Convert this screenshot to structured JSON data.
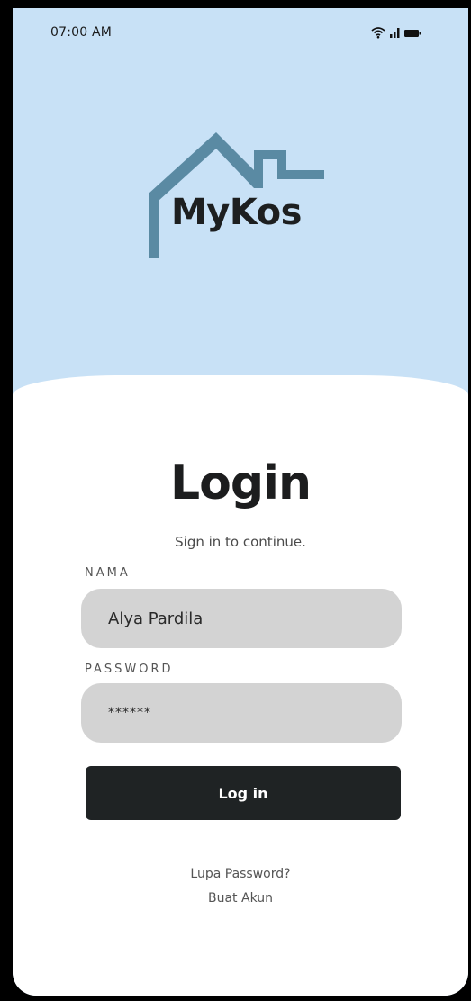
{
  "status_bar": {
    "time": "07:00 AM",
    "icons": [
      "wifi-icon",
      "signal-icon",
      "battery-icon"
    ]
  },
  "brand": {
    "name": "MyKos",
    "logo_icon": "house-icon",
    "logo_color": "#5a8aa3"
  },
  "login": {
    "title": "Login",
    "subtitle": "Sign in to continue.",
    "name_label": "NAMA",
    "name_value": "Alya Pardila",
    "password_label": "PASSWORD",
    "password_value": "******",
    "submit_label": "Log in",
    "forgot_link": "Lupa Password?",
    "create_account_link": "Buat Akun"
  },
  "colors": {
    "header_bg": "#c8e1f6",
    "field_bg": "#d3d3d3",
    "button_bg": "#1f2324"
  }
}
